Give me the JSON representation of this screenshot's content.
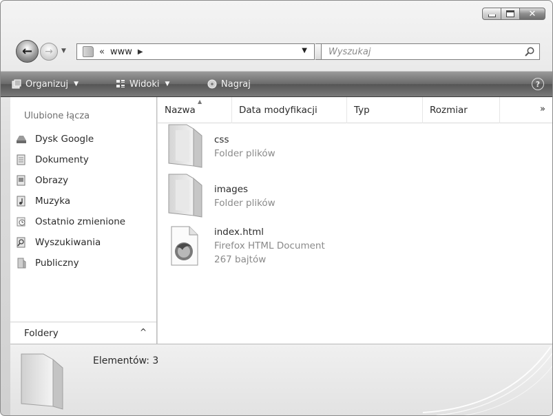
{
  "window": {
    "caption_buttons": [
      "minimize",
      "maximize",
      "close"
    ]
  },
  "nav": {
    "address_chevron": "«",
    "address_path": "www",
    "search_placeholder": "Wyszukaj"
  },
  "toolbar": {
    "organize": "Organizuj",
    "views": "Widoki",
    "burn": "Nagraj"
  },
  "sidebar": {
    "title": "Ulubione łącza",
    "items": [
      {
        "label": "Dysk Google",
        "icon": "google-drive-icon"
      },
      {
        "label": "Dokumenty",
        "icon": "documents-icon"
      },
      {
        "label": "Obrazy",
        "icon": "pictures-icon"
      },
      {
        "label": "Muzyka",
        "icon": "music-icon"
      },
      {
        "label": "Ostatnio zmienione",
        "icon": "recent-icon"
      },
      {
        "label": "Wyszukiwania",
        "icon": "searches-icon"
      },
      {
        "label": "Publiczny",
        "icon": "public-folder-icon"
      }
    ],
    "folders_label": "Foldery"
  },
  "columns": {
    "name": "Nazwa",
    "date": "Data modyfikacji",
    "type": "Typ",
    "size": "Rozmiar",
    "more": "»"
  },
  "files": [
    {
      "name": "css",
      "type": "Folder plików",
      "icon": "folder-icon"
    },
    {
      "name": "images",
      "type": "Folder plików",
      "icon": "folder-icon"
    },
    {
      "name": "index.html",
      "type": "Firefox HTML Document",
      "size": "267 bajtów",
      "icon": "firefox-document-icon"
    }
  ],
  "details": {
    "count_label": "Elementów: 3"
  }
}
